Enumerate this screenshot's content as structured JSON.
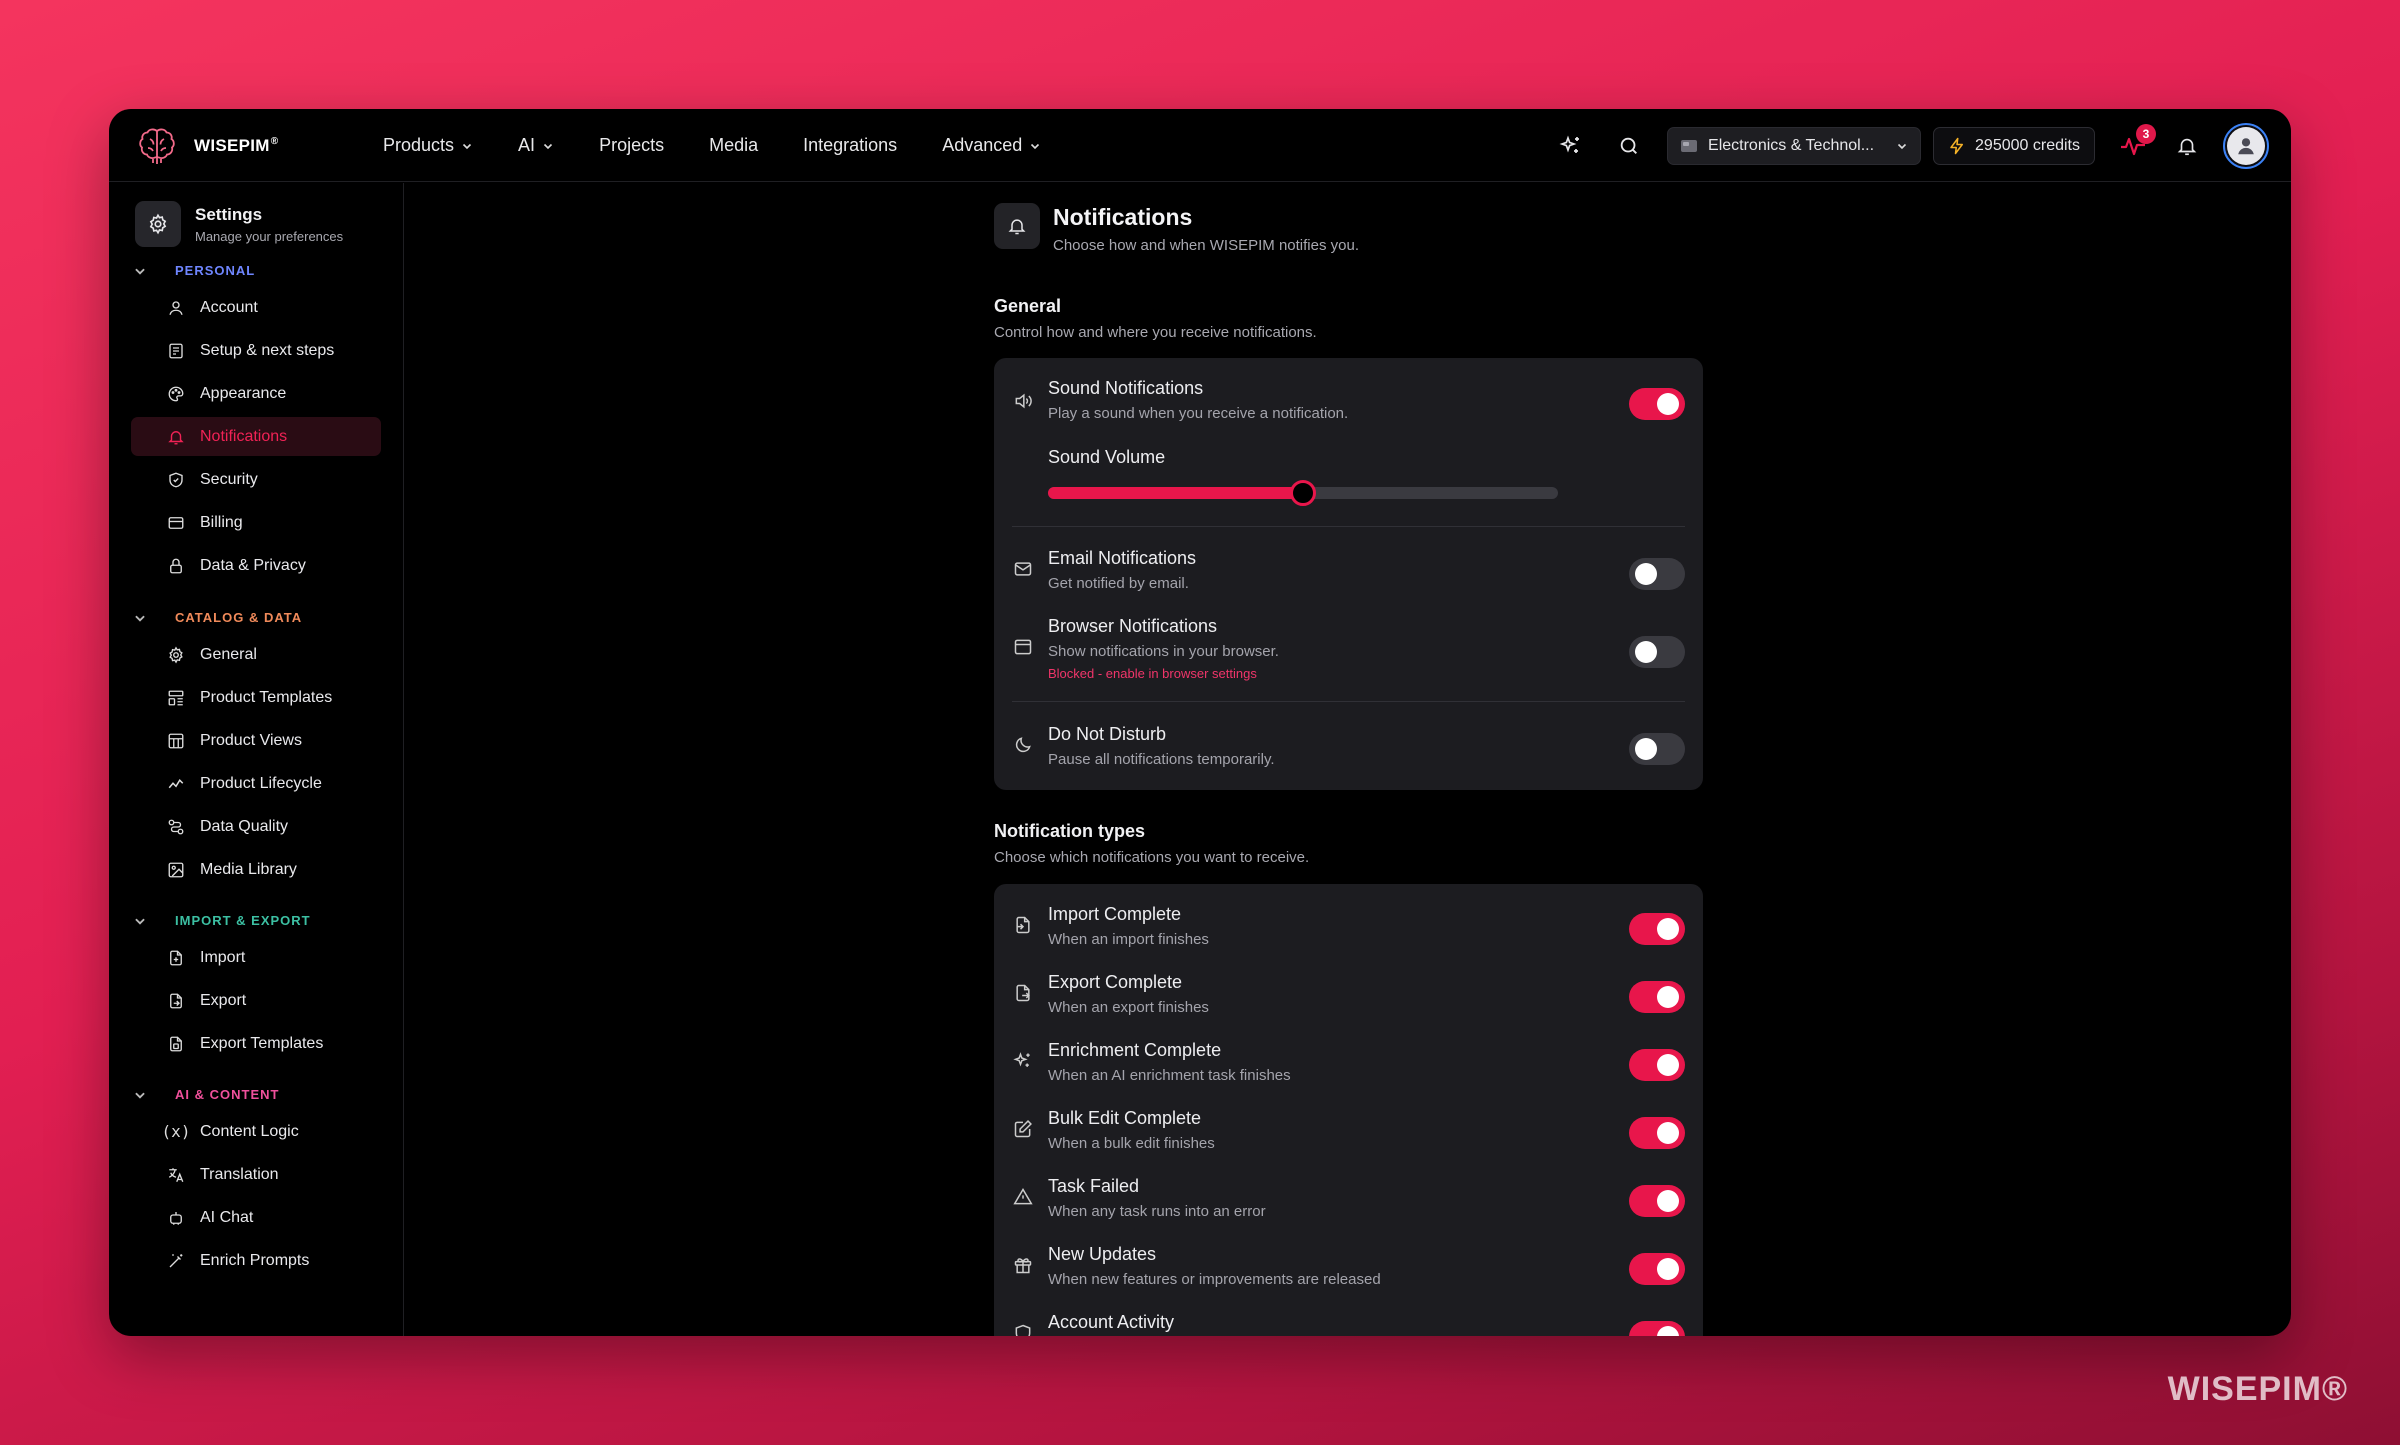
{
  "brand": {
    "name": "WISEPIM",
    "reg": "®",
    "watermark": "WISEPIM®"
  },
  "nav": {
    "items": [
      {
        "label": "Products",
        "dropdown": true
      },
      {
        "label": "AI",
        "dropdown": true
      },
      {
        "label": "Projects",
        "dropdown": false
      },
      {
        "label": "Media",
        "dropdown": false
      },
      {
        "label": "Integrations",
        "dropdown": false
      },
      {
        "label": "Advanced",
        "dropdown": true
      }
    ]
  },
  "topbar": {
    "workspace": "Electronics & Technol...",
    "credits": "295000 credits",
    "activity_badge": "3",
    "icons": [
      "sparkles-icon",
      "search-icon",
      "workspace-icon",
      "bolt-icon",
      "activity-icon",
      "bell-icon",
      "user-icon"
    ]
  },
  "sidebar": {
    "title": "Settings",
    "subtitle": "Manage your preferences",
    "sections": [
      {
        "label": "PERSONAL",
        "color": "#6f86ff",
        "items": [
          {
            "label": "Account",
            "icon": "user-icon"
          },
          {
            "label": "Setup & next steps",
            "icon": "checklist-icon"
          },
          {
            "label": "Appearance",
            "icon": "palette-icon"
          },
          {
            "label": "Notifications",
            "icon": "bell-icon",
            "active": true
          },
          {
            "label": "Security",
            "icon": "shield-icon"
          },
          {
            "label": "Billing",
            "icon": "credit-card-icon"
          },
          {
            "label": "Data & Privacy",
            "icon": "lock-icon"
          }
        ]
      },
      {
        "label": "CATALOG & DATA",
        "color": "#f08a5a",
        "items": [
          {
            "label": "General",
            "icon": "gear-icon"
          },
          {
            "label": "Product Templates",
            "icon": "template-icon"
          },
          {
            "label": "Product Views",
            "icon": "table-icon"
          },
          {
            "label": "Product Lifecycle",
            "icon": "trend-icon"
          },
          {
            "label": "Data Quality",
            "icon": "workflow-icon"
          },
          {
            "label": "Media Library",
            "icon": "image-icon"
          }
        ]
      },
      {
        "label": "IMPORT & EXPORT",
        "color": "#3cc0a3",
        "items": [
          {
            "label": "Import",
            "icon": "file-import-icon"
          },
          {
            "label": "Export",
            "icon": "file-export-icon"
          },
          {
            "label": "Export Templates",
            "icon": "file-template-icon"
          }
        ]
      },
      {
        "label": "AI & CONTENT",
        "color": "#f0509b",
        "items": [
          {
            "label": "Content Logic",
            "icon": "variable-icon"
          },
          {
            "label": "Translation",
            "icon": "translate-icon"
          },
          {
            "label": "AI Chat",
            "icon": "bot-icon"
          },
          {
            "label": "Enrich Prompts",
            "icon": "wand-icon"
          }
        ]
      }
    ]
  },
  "page": {
    "title": "Notifications",
    "subtitle": "Choose how and when WISEPIM notifies you.",
    "general": {
      "title": "General",
      "subtitle": "Control how and where you receive notifications.",
      "sound": {
        "title": "Sound Notifications",
        "subtitle": "Play a sound when you receive a notification.",
        "enabled": true
      },
      "volume": {
        "label": "Sound Volume",
        "value": 0.5
      },
      "email": {
        "title": "Email Notifications",
        "subtitle": "Get notified by email.",
        "enabled": false
      },
      "browser": {
        "title": "Browser Notifications",
        "subtitle": "Show notifications in your browser.",
        "warning": "Blocked - enable in browser settings",
        "enabled": false
      },
      "dnd": {
        "title": "Do Not Disturb",
        "subtitle": "Pause all notifications temporarily.",
        "enabled": false
      }
    },
    "types": {
      "title": "Notification types",
      "subtitle": "Choose which notifications you want to receive.",
      "items": [
        {
          "title": "Import Complete",
          "subtitle": "When an import finishes",
          "enabled": true,
          "icon": "file-import-icon"
        },
        {
          "title": "Export Complete",
          "subtitle": "When an export finishes",
          "enabled": true,
          "icon": "file-export-icon"
        },
        {
          "title": "Enrichment Complete",
          "subtitle": "When an AI enrichment task finishes",
          "enabled": true,
          "icon": "sparkles-icon"
        },
        {
          "title": "Bulk Edit Complete",
          "subtitle": "When a bulk edit finishes",
          "enabled": true,
          "icon": "edit-icon"
        },
        {
          "title": "Task Failed",
          "subtitle": "When any task runs into an error",
          "enabled": true,
          "icon": "warning-icon"
        },
        {
          "title": "New Updates",
          "subtitle": "When new features or improvements are released",
          "enabled": true,
          "icon": "gift-icon"
        },
        {
          "title": "Account Activity",
          "subtitle": "",
          "enabled": true,
          "icon": "shield-icon"
        }
      ]
    }
  }
}
